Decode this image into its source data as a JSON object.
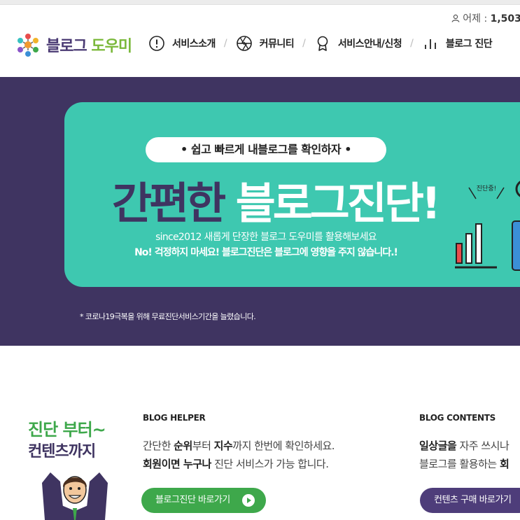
{
  "utility": {
    "visitors_label": "어제 : ",
    "visitors_value": "1,503",
    "visitors_suffix": " / ,"
  },
  "header": {
    "logo_part1": "블로그",
    "logo_part2": "도우미",
    "nav": [
      {
        "label": "서비스소개",
        "icon": "info-circle-icon"
      },
      {
        "label": "커뮤니티",
        "icon": "aperture-icon"
      },
      {
        "label": "서비스안내/신청",
        "icon": "ribbon-award-icon"
      },
      {
        "label": "블로그 진단",
        "icon": "bar-chart-icon"
      }
    ],
    "separator": "/"
  },
  "hero": {
    "pill_text": "• 쉽고 빠르게 내블로그를 확인하자 •",
    "headline_dark": "간편한",
    "headline_light": "블로그진단!",
    "subline": "since2012 새롭게 단장한 블로그 도우미를 활용해보세요",
    "subline_bold": "No! 걱정하지 마세요! 블로그진단은 블로그에 영향을 주지 않습니다.!",
    "notice": "* 코로나19극복을 위해 무료진단서비스기간을 늘렸습니다.",
    "illustration_tag": "진단중!"
  },
  "promo": {
    "line1": "진단 부터~",
    "line2": "컨텐츠까지"
  },
  "blog_helper": {
    "title": "BLOG HELPER",
    "line1_a": "간단한 ",
    "line1_b": "순위",
    "line1_c": "부터 ",
    "line1_d": "지수",
    "line1_e": "까지 한번에 확인하세요.",
    "line2_a": "회원이면 누구나",
    "line2_b": " 진단 서비스가 가능 합니다.",
    "button": "블로그진단 바로가기"
  },
  "blog_contents": {
    "title": "BLOG CONTENTS",
    "line1_a": "일상글을",
    "line1_b": " 자주 쓰시나",
    "line2_a": "블로그를 활용하는 ",
    "line2_b": "회",
    "button": "컨텐츠 구매 바로가기"
  },
  "colors": {
    "brand_purple": "#3f3461",
    "brand_green": "#3ea84b",
    "hero_teal": "#3ec8b0",
    "button_purple": "#4e3d7a"
  }
}
